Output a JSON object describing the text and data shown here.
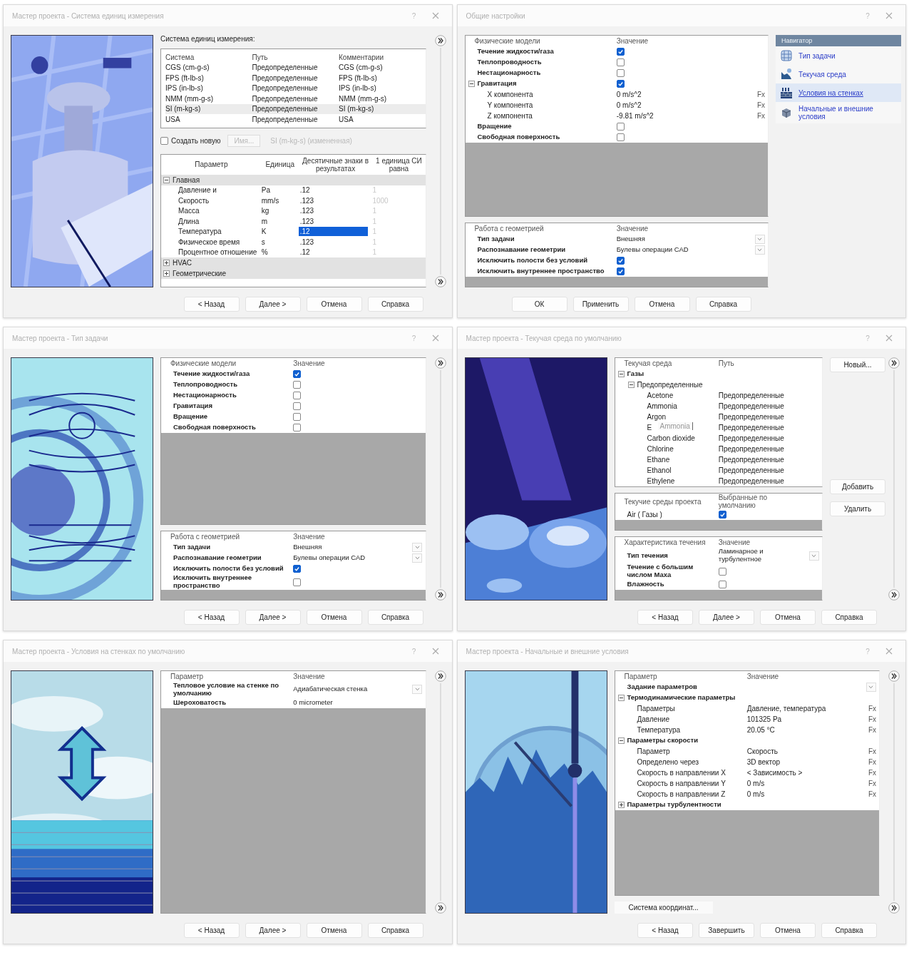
{
  "dialogs": [
    {
      "title": "Мастер проекта - Система единиц измерения",
      "help": "?",
      "picture": {
        "kind": "picture"
      },
      "sections": [
        {
          "kind": "caption",
          "text": "Система единиц измерения:"
        },
        {
          "kind": "list",
          "columns": [
            "Система",
            "Путь",
            "Комментарии"
          ],
          "rows": [
            {
              "cells": [
                "CGS (cm-g-s)",
                "Предопределенные",
                "CGS (cm-g-s)"
              ],
              "selected": false
            },
            {
              "cells": [
                "FPS (ft-lb-s)",
                "Предопределенные",
                "FPS (ft-lb-s)"
              ],
              "selected": false
            },
            {
              "cells": [
                "IPS (in-lb-s)",
                "Предопределенные",
                "IPS (in-lb-s)"
              ],
              "selected": false
            },
            {
              "cells": [
                "NMM (mm-g-s)",
                "Предопределенные",
                "NMM (mm-g-s)"
              ],
              "selected": false
            },
            {
              "cells": [
                "SI (m-kg-s)",
                "Предопределенные",
                "SI (m-kg-s)"
              ],
              "selected": true
            },
            {
              "cells": [
                "USA",
                "Предопределенные",
                "USA"
              ],
              "selected": false
            }
          ]
        },
        {
          "kind": "create",
          "label": "Создать новую",
          "checked": false,
          "button": "Имя...",
          "disabled": true,
          "value": "SI (m-kg-s) (измененная)"
        },
        {
          "kind": "units",
          "columns": [
            "Параметр",
            "Единица",
            "Десятичные знаки в результатах",
            "1 единица СИ равна"
          ],
          "groups": [
            {
              "label": "Главная",
              "expanded": true,
              "rows": [
                {
                  "name": "Давление и",
                  "unit": "Pa",
                  "decimals": ".12",
                  "factor": "1",
                  "selected": false
                },
                {
                  "name": "Скорость",
                  "unit": "mm/s",
                  "decimals": ".123",
                  "factor": "1000",
                  "selected": false
                },
                {
                  "name": "Масса",
                  "unit": "kg",
                  "decimals": ".123",
                  "factor": "1",
                  "selected": false
                },
                {
                  "name": "Длина",
                  "unit": "m",
                  "decimals": ".123",
                  "factor": "1",
                  "selected": false
                },
                {
                  "name": "Температура",
                  "unit": "K",
                  "decimals": ".12",
                  "factor": "1",
                  "selected": true
                },
                {
                  "name": "Физическое время",
                  "unit": "s",
                  "decimals": ".123",
                  "factor": "1",
                  "selected": false
                },
                {
                  "name": "Процентное отношение",
                  "unit": "%",
                  "decimals": ".12",
                  "factor": "1",
                  "selected": false
                }
              ]
            },
            {
              "label": "HVAC",
              "expanded": false
            },
            {
              "label": "Геометрические",
              "expanded": false
            }
          ]
        }
      ],
      "buttons": [
        "< Назад",
        "Далее >",
        "Отмена",
        "Справка"
      ]
    },
    {
      "title": "Общие настройки",
      "help": "?",
      "sections": [
        {
          "kind": "props",
          "columns": [
            "Физические модели",
            "Значение"
          ],
          "rows": [
            {
              "label": "Течение жидкости/газа",
              "bold": true,
              "checked": true
            },
            {
              "label": "Теплопроводность",
              "bold": true,
              "checked": false
            },
            {
              "label": "Нестационарность",
              "bold": true,
              "checked": false
            },
            {
              "label": "Гравитация",
              "bold": true,
              "checked": true,
              "expanded": true,
              "children": [
                {
                  "label": "X компонента",
                  "value": "0 m/s^2",
                  "fx": "Fx"
                },
                {
                  "label": "Y компонента",
                  "value": "0 m/s^2",
                  "fx": "Fx"
                },
                {
                  "label": "Z компонента",
                  "value": "-9.81 m/s^2",
                  "fx": "Fx"
                }
              ]
            },
            {
              "label": "Вращение",
              "bold": true,
              "checked": false
            },
            {
              "label": "Свободная поверхность",
              "bold": true,
              "checked": false
            }
          ]
        },
        {
          "kind": "props",
          "columns": [
            "Работа с геометрией",
            "Значение"
          ],
          "rows": [
            {
              "label": "Тип задачи",
              "bold": true,
              "value": "Внешняя",
              "dropdown": true
            },
            {
              "label": "Распознавание геометрии",
              "bold": true,
              "value": "Булевы операции CAD",
              "dropdown": true
            },
            {
              "label": "Исключить полости без условий",
              "bold": true,
              "checked": true
            },
            {
              "label": "Исключить внутреннее пространство",
              "bold": true,
              "checked": true
            }
          ]
        }
      ],
      "navigator": {
        "title": "Навигатор",
        "items": [
          {
            "label": "Тип задачи",
            "selected": false
          },
          {
            "label": "Текучая среда",
            "selected": false
          },
          {
            "label": "Условия на стенках",
            "selected": true
          },
          {
            "label": "Начальные и внешние условия",
            "selected": false
          }
        ]
      },
      "buttons": [
        "ОК",
        "Применить",
        "Отмена",
        "Справка"
      ]
    },
    {
      "title": "Мастер проекта - Тип задачи",
      "help": "?",
      "picture": {
        "kind": "picture"
      },
      "sections": [
        {
          "kind": "props",
          "columns": [
            "Физические модели",
            "Значение"
          ],
          "rows": [
            {
              "label": "Течение жидкости/газа",
              "bold": true,
              "checked": true
            },
            {
              "label": "Теплопроводность",
              "bold": true,
              "checked": false
            },
            {
              "label": "Нестационарность",
              "bold": true,
              "checked": false
            },
            {
              "label": "Гравитация",
              "bold": true,
              "checked": false
            },
            {
              "label": "Вращение",
              "bold": true,
              "checked": false
            },
            {
              "label": "Свободная поверхность",
              "bold": true,
              "checked": false
            }
          ]
        },
        {
          "kind": "props",
          "columns": [
            "Работа с геометрией",
            "Значение"
          ],
          "rows": [
            {
              "label": "Тип задачи",
              "bold": true,
              "value": "Внешняя",
              "dropdown": true
            },
            {
              "label": "Распознавание геометрии",
              "bold": true,
              "value": "Булевы операции CAD",
              "dropdown": true
            },
            {
              "label": "Исключить полости без условий",
              "bold": true,
              "checked": true
            },
            {
              "label": "Исключить внутреннее пространство",
              "bold": true,
              "checked": false
            }
          ]
        }
      ],
      "buttons": [
        "< Назад",
        "Далее >",
        "Отмена",
        "Справка"
      ]
    },
    {
      "title": "Мастер проекта - Текучая среда по умолчанию",
      "help": "?",
      "picture": {
        "kind": "picture"
      },
      "sections": [
        {
          "kind": "props",
          "columns": [
            "Текучая среда",
            "Путь"
          ],
          "rows": [
            {
              "label": "Газы",
              "bold": true,
              "expanded": true,
              "children": [
                {
                  "label": "Предопределенные",
                  "expanded": true,
                  "children": [
                    {
                      "label": "Acetone",
                      "value": "Предопределенные"
                    },
                    {
                      "label": "Ammonia",
                      "value": "Предопределенные"
                    },
                    {
                      "label": "Argon",
                      "value": "Предопределенные"
                    },
                    {
                      "label": "E",
                      "value": "Предопределенные",
                      "drag_label": "Ammonia"
                    },
                    {
                      "label": "Carbon dioxide",
                      "value": "Предопределенные"
                    },
                    {
                      "label": "Chlorine",
                      "value": "Предопределенные"
                    },
                    {
                      "label": "Ethane",
                      "value": "Предопределенные"
                    },
                    {
                      "label": "Ethanol",
                      "value": "Предопределенные"
                    },
                    {
                      "label": "Ethylene",
                      "value": "Предопределенные"
                    }
                  ]
                }
              ]
            }
          ]
        },
        {
          "kind": "props",
          "columns": [
            "Текучие среды проекта",
            "Выбранные по умолчанию"
          ],
          "rows": [
            {
              "label": "Air ( Газы )",
              "checked": true
            }
          ]
        },
        {
          "kind": "props",
          "columns": [
            "Характеристика течения",
            "Значение"
          ],
          "rows": [
            {
              "label": "Тип течения",
              "bold": true,
              "value": "Ламинарное и турбулентное",
              "dropdown": true
            },
            {
              "label": "Течение с большим числом Маха",
              "bold": true,
              "checked": false
            },
            {
              "label": "Влажность",
              "bold": true,
              "checked": false
            }
          ]
        }
      ],
      "side_buttons": [
        "Новый...",
        "Добавить",
        "Удалить"
      ],
      "buttons": [
        "< Назад",
        "Далее >",
        "Отмена",
        "Справка"
      ]
    },
    {
      "title": "Мастер проекта - Условия на стенках по умолчанию",
      "help": "?",
      "picture": {
        "kind": "picture"
      },
      "sections": [
        {
          "kind": "props",
          "columns": [
            "Параметр",
            "Значение"
          ],
          "rows": [
            {
              "label": "Тепловое условие на стенке по умолчанию",
              "bold": true,
              "value": "Адиабатическая стенка",
              "dropdown": true
            },
            {
              "label": "Шероховатость",
              "bold": true,
              "value": "0 micrometer"
            }
          ]
        }
      ],
      "buttons": [
        "< Назад",
        "Далее >",
        "Отмена",
        "Справка"
      ]
    },
    {
      "title": "Мастер проекта - Начальные и внешние условия",
      "help": "?",
      "picture": {
        "kind": "picture"
      },
      "sections": [
        {
          "kind": "props",
          "columns": [
            "Параметр",
            "Значение"
          ],
          "rows": [
            {
              "label": "Задание параметров",
              "bold": true,
              "dropdown": true
            },
            {
              "label": "Термодинамические параметры",
              "bold": true,
              "expanded": true,
              "children": [
                {
                  "label": "Параметры",
                  "value": "Давление, температура",
                  "fx": "Fx"
                },
                {
                  "label": "Давление",
                  "value": "101325 Pa",
                  "fx": "Fx"
                },
                {
                  "label": "Температура",
                  "value": "20.05 °C",
                  "fx": "Fx"
                }
              ]
            },
            {
              "label": "Параметры скорости",
              "bold": true,
              "expanded": true,
              "children": [
                {
                  "label": "Параметр",
                  "value": "Скорость",
                  "fx": "Fx"
                },
                {
                  "label": "Определено через",
                  "value": "3D вектор",
                  "fx": "Fx"
                },
                {
                  "label": "Скорость в направлении X",
                  "value": "< Зависимость >",
                  "fx": "Fx"
                },
                {
                  "label": "Скорость в направлении Y",
                  "value": "0 m/s",
                  "fx": "Fx"
                },
                {
                  "label": "Скорость в направлении Z",
                  "value": "0 m/s",
                  "fx": "Fx"
                }
              ]
            },
            {
              "label": "Параметры турбулентности",
              "bold": true,
              "expanded": false
            }
          ]
        },
        {
          "kind": "button",
          "label": "Система координат..."
        }
      ],
      "buttons": [
        "< Назад",
        "Завершить",
        "Отмена",
        "Справка"
      ]
    }
  ]
}
